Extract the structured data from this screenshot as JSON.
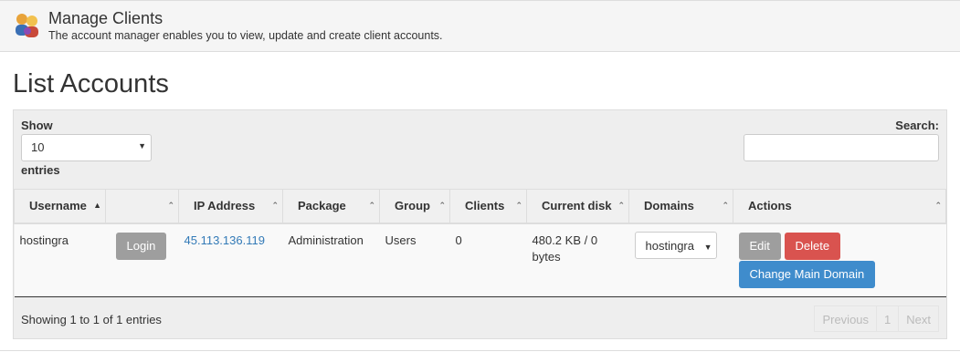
{
  "header": {
    "title": "Manage Clients",
    "description": "The account manager enables you to view, update and create client accounts.",
    "icon": "users-icon"
  },
  "page_title": "List Accounts",
  "controls": {
    "show_label": "Show",
    "entries_value": "10",
    "entries_label": "entries",
    "search_label": "Search:",
    "search_value": ""
  },
  "table": {
    "columns": [
      "Username",
      "",
      "IP Address",
      "Package",
      "Group",
      "Clients",
      "Current disk",
      "Domains",
      "Actions"
    ],
    "rows": [
      {
        "username": "hostingra",
        "login_label": "Login",
        "ip": "45.113.136.119",
        "package": "Administration",
        "group": "Users",
        "clients": "0",
        "disk": "480.2 KB / 0 bytes",
        "domain_selected": "hostingra",
        "edit_label": "Edit",
        "delete_label": "Delete",
        "change_domain_label": "Change Main Domain"
      }
    ]
  },
  "footer": {
    "info": "Showing 1 to 1 of 1 entries",
    "previous": "Previous",
    "page": "1",
    "next": "Next"
  },
  "colors": {
    "link": "#337ab7",
    "delete": "#d9534f",
    "primary": "#3f8ccc",
    "neutral_button": "#9e9e9e"
  }
}
